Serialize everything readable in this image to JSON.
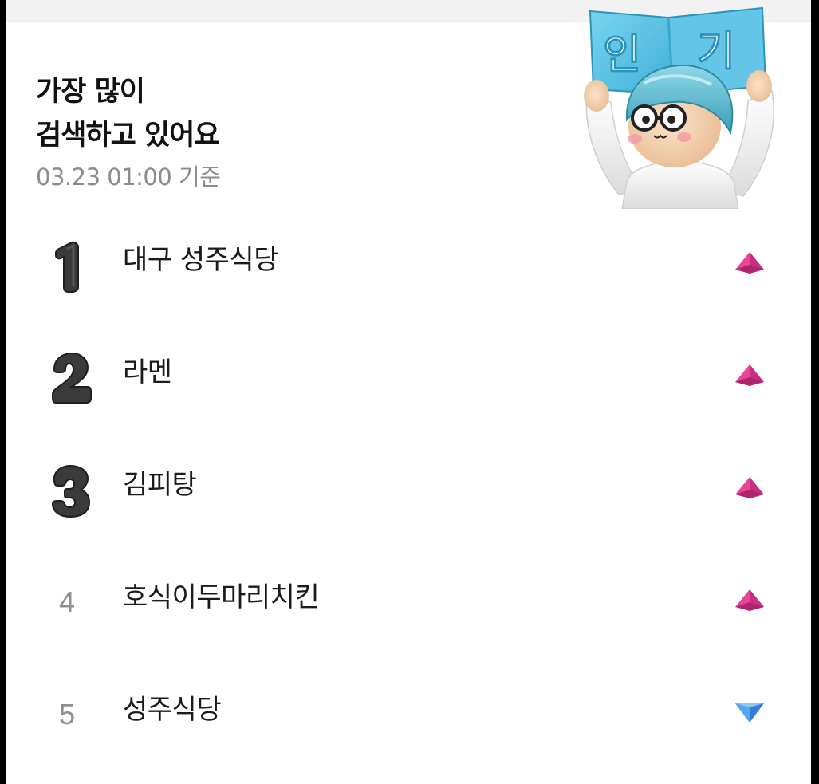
{
  "header": {
    "title_line1": "가장 많이",
    "title_line2": "검색하고 있어요",
    "timestamp": "03.23 01:00 기준",
    "mascot_sign_text": "인 기"
  },
  "ranking": [
    {
      "rank": "1",
      "keyword": "대구 성주식당",
      "trend": "up",
      "rank_style": "3d"
    },
    {
      "rank": "2",
      "keyword": "라멘",
      "trend": "up",
      "rank_style": "3d"
    },
    {
      "rank": "3",
      "keyword": "김피탕",
      "trend": "up",
      "rank_style": "3d"
    },
    {
      "rank": "4",
      "keyword": "호식이두마리치킨",
      "trend": "up",
      "rank_style": "plain"
    },
    {
      "rank": "5",
      "keyword": "성주식당",
      "trend": "down",
      "rank_style": "plain"
    }
  ],
  "icons": {
    "trend_up": "triangle-up-icon",
    "trend_down": "triangle-down-icon"
  },
  "colors": {
    "trend_up": "#e8449a",
    "trend_down": "#2f7fd6",
    "title": "#111111",
    "timestamp": "#8c8c8c",
    "rank_plain": "#8f8f8f",
    "sign_blue": "#5cc4e6"
  }
}
